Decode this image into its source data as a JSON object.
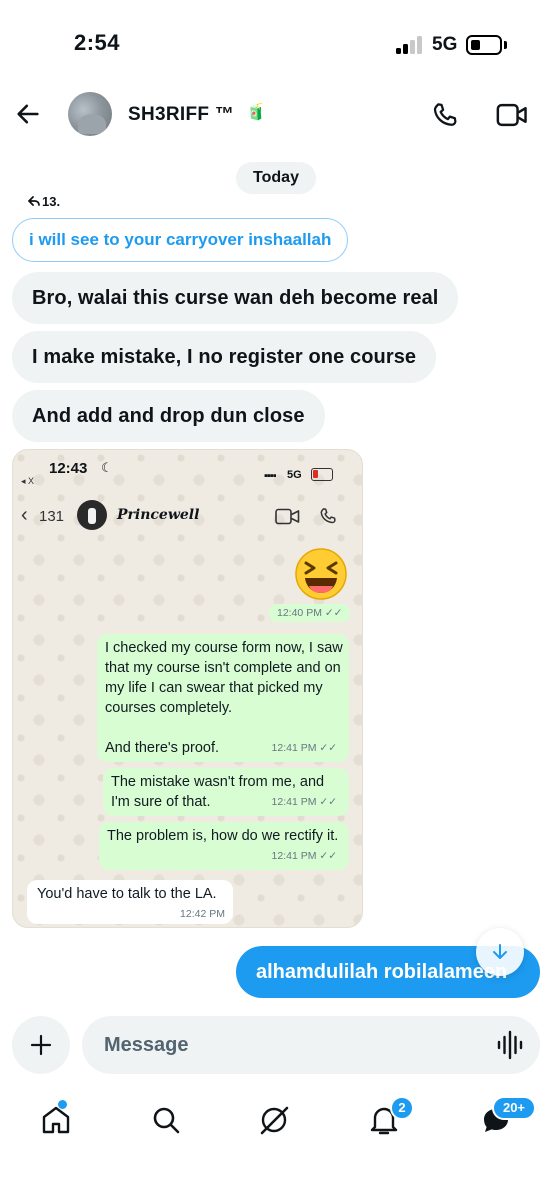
{
  "status_bar": {
    "time": "2:54",
    "network": "5G"
  },
  "header": {
    "contact_name": "SH3RIFF ™",
    "contact_emoji": "🧃"
  },
  "thread": {
    "date_separator": "Today",
    "reply_reference": "13.",
    "quoted_message": "i will see to your carryover inshaallah",
    "incoming_messages": [
      "Bro, walai this curse wan deh become real",
      "I make mistake, I no register one course",
      "And add and drop dun close"
    ],
    "own_message": "alhamdulilah robilalameen"
  },
  "attached_screenshot": {
    "status_time": "12:43",
    "back_app": "◂ X",
    "network": "5G",
    "back_count": "131",
    "contact_name": "Princewell",
    "emoji_time": "12:40 PM",
    "outgoing": [
      {
        "text": "I checked my course form now, I saw that my course isn't complete and on my life I can swear that picked my courses completely.\n\nAnd there's proof.",
        "time": "12:41 PM"
      },
      {
        "text": "The mistake wasn't from me, and I'm sure of that.",
        "time": "12:41 PM"
      },
      {
        "text": "The problem is, how do we rectify it.",
        "time": "12:41 PM"
      }
    ],
    "incoming": {
      "text": "You'd have to talk to the LA.",
      "time": "12:42 PM"
    }
  },
  "composer": {
    "placeholder": "Message"
  },
  "bottom_nav": {
    "notifications_badge": "2",
    "messages_badge": "20+"
  },
  "colors": {
    "accent": "#1d9bf0",
    "bubble_gray": "#eff3f4",
    "whatsapp_outgoing": "#d9fdd3"
  },
  "icons": [
    "back-arrow-icon",
    "phone-icon",
    "video-icon",
    "reply-icon",
    "plus-icon",
    "voice-icon",
    "arrow-down-icon",
    "home-icon",
    "search-icon",
    "grok-icon",
    "bell-icon",
    "mail-icon"
  ]
}
